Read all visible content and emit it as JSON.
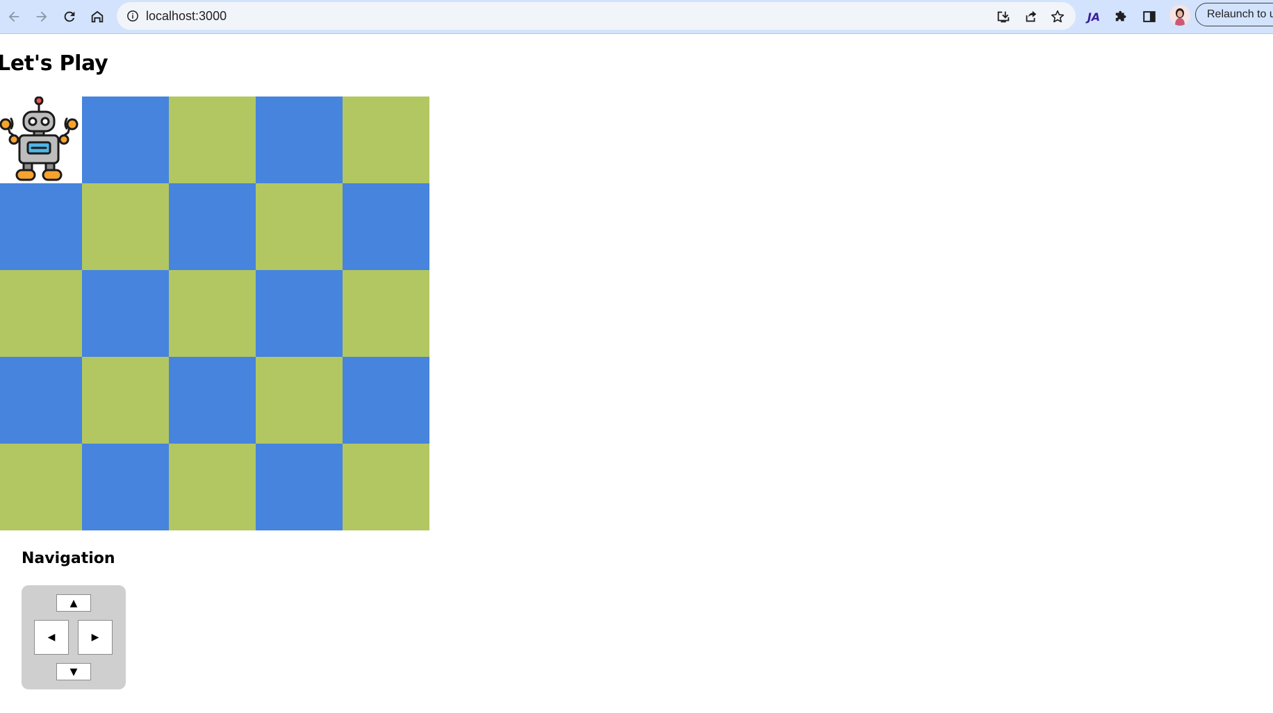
{
  "browser": {
    "url": "localhost:3000",
    "relaunch_label": "Relaunch to up",
    "extension_label": "JA",
    "icons": [
      "back-icon",
      "forward-icon",
      "reload-icon",
      "home-icon",
      "site-info-icon",
      "install-icon",
      "share-icon",
      "bookmark-star-icon",
      "extensions-puzzle-icon",
      "side-panel-icon"
    ]
  },
  "page": {
    "title": "Let's Play",
    "navigation_heading": "Navigation"
  },
  "board": {
    "rows": 5,
    "cols": 5,
    "robot_position": {
      "row": 0,
      "col": 0
    },
    "colors": {
      "blue": "#4684dd",
      "green": "#b2c761"
    }
  },
  "controls": {
    "up": "▲",
    "down": "▼",
    "left": "◀",
    "right": "▶"
  }
}
